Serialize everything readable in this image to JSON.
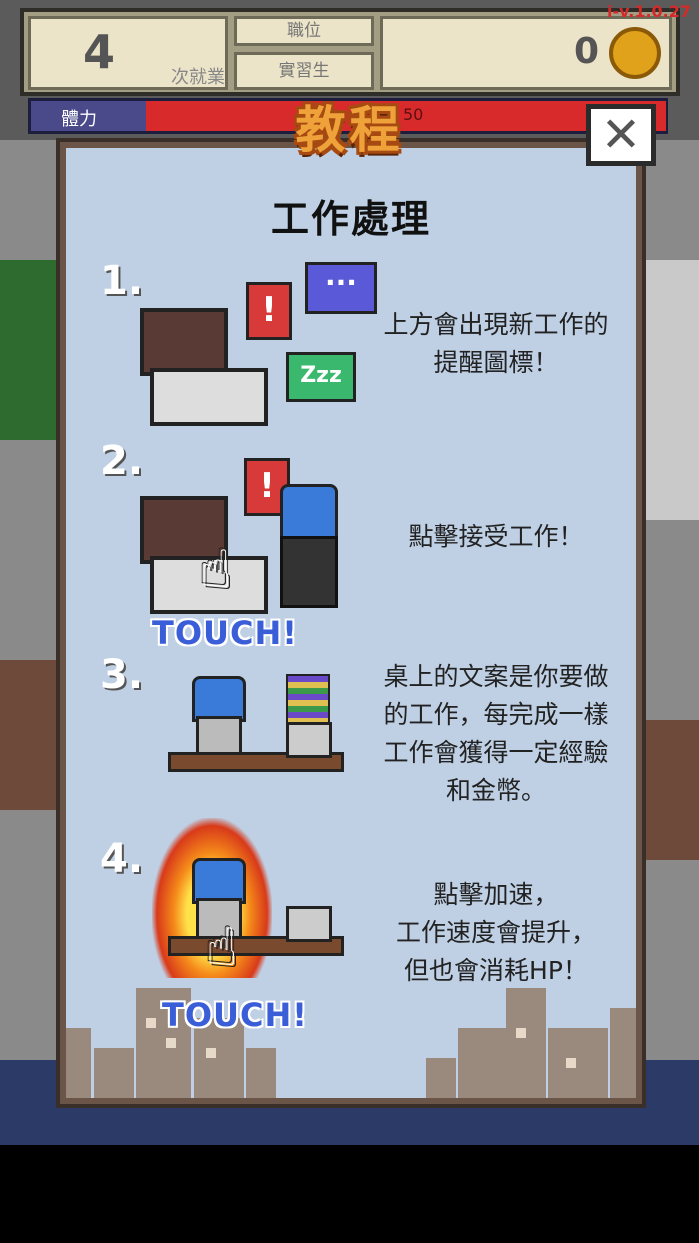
{
  "hud": {
    "days_count": "4",
    "days_label": "次就業",
    "position_header": "職位",
    "position_value": "實習生",
    "coins": "0",
    "version": "i-v.1.0.27",
    "hp_label": "體力",
    "hp_value": "50"
  },
  "tutorial": {
    "title": "教程",
    "close_label": "✕",
    "subtitle": "工作處理",
    "steps": [
      {
        "num": "1.",
        "text_lines": [
          "上方會出現新工作的",
          "提醒圖標！"
        ]
      },
      {
        "num": "2.",
        "text_lines": [
          "點擊接受工作！"
        ],
        "touch": "TOUCH!"
      },
      {
        "num": "3.",
        "text_lines": [
          "桌上的文案是你要做",
          "的工作，每完成一樣",
          "工作會獲得一定經驗",
          "和金幣。"
        ]
      },
      {
        "num": "4.",
        "text_lines": [
          "點擊加速，",
          "工作速度會提升，",
          "但也會消耗HP！"
        ],
        "touch": "TOUCH!"
      }
    ],
    "zzz_text": "Zzz"
  },
  "icons": [
    "coin-icon",
    "close-icon",
    "exclamation-bubble-icon",
    "chat-bubble-icon",
    "sleep-bubble-icon",
    "hand-pointer-icon",
    "fire-icon",
    "telephone-icon"
  ],
  "colors": {
    "title": "#f0a23a",
    "panel": "#bfd0e5",
    "touch": "#3a5ed8",
    "hp": "#d82a2a"
  }
}
